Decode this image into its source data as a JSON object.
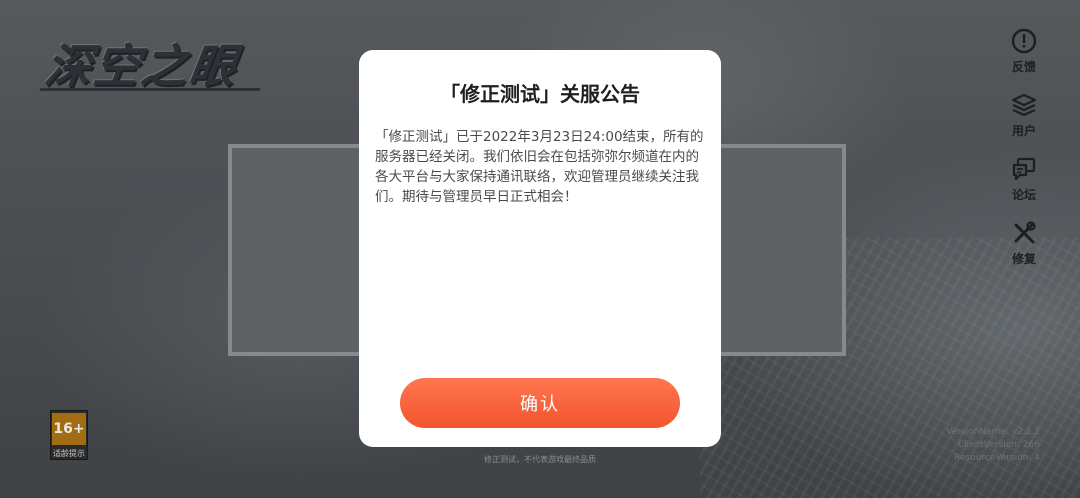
{
  "background": {
    "logo_text": "深空之眼"
  },
  "right_nav": [
    {
      "icon": "feedback-icon",
      "label": "反馈"
    },
    {
      "icon": "layers-icon",
      "label": "用户"
    },
    {
      "icon": "forum-icon",
      "label": "论坛"
    },
    {
      "icon": "repair-icon",
      "label": "修复"
    }
  ],
  "age_rating": {
    "value": "16+",
    "label": "适龄提示"
  },
  "version_info": {
    "version_name": "VersionName: v2.2.2",
    "client_version": "ClientVersion: 266",
    "resource_version": "ResourceVersion: 4"
  },
  "footer": {
    "notice": "修正测试，不代表游戏最终品质"
  },
  "dialog": {
    "title": "「修正测试」关服公告",
    "body": "「修正测试」已于2022年3月23日24:00结束，所有的服务器已经关闭。我们依旧会在包括弥弥尔频道在内的各大平台与大家保持通讯联络，欢迎管理员继续关注我们。期待与管理员早日正式相会！",
    "confirm_label": "确认"
  },
  "colors": {
    "accent": "#f4582f",
    "dialog_bg": "#ffffff",
    "overlay": "#4e5154"
  }
}
